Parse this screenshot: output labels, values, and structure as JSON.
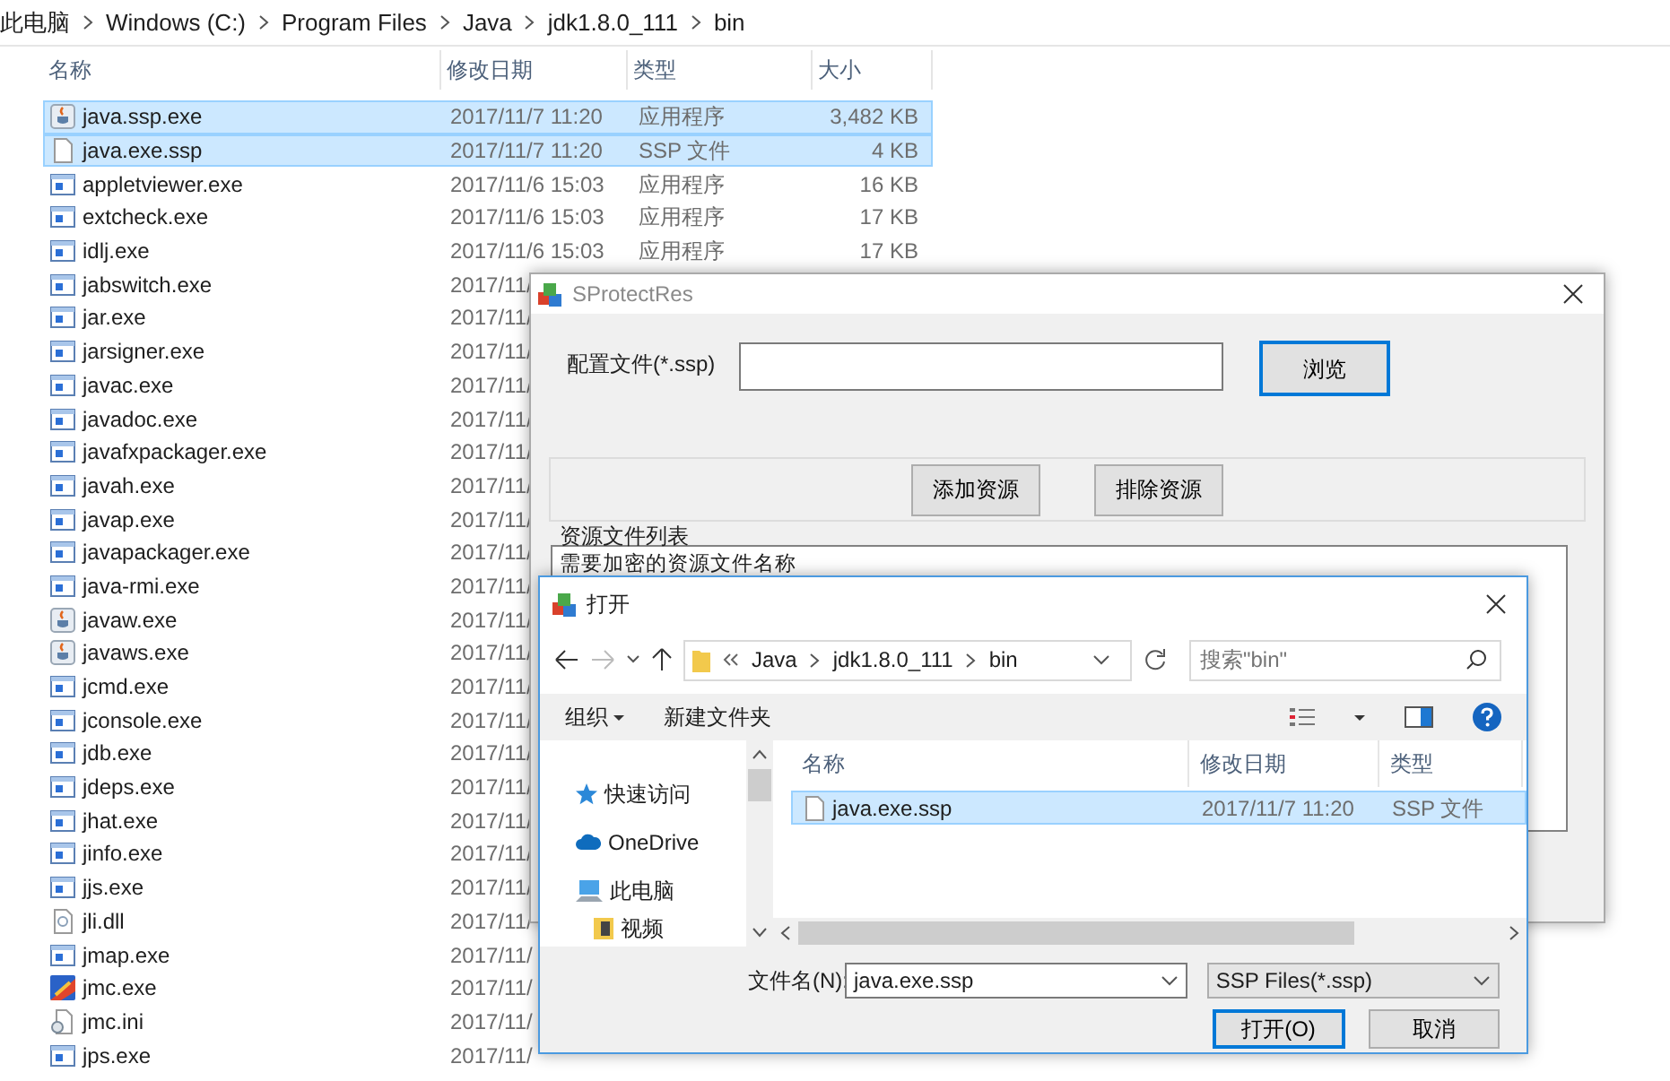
{
  "explorer": {
    "breadcrumb": [
      "此电脑",
      "Windows (C:)",
      "Program Files",
      "Java",
      "jdk1.8.0_111",
      "bin"
    ],
    "columns": [
      "名称",
      "修改日期",
      "类型",
      "大小"
    ],
    "files": [
      {
        "name": "java.ssp.exe",
        "kind": "java",
        "date": "2017/11/7 11:20",
        "type": "应用程序",
        "size": "3,482 KB",
        "selected": true
      },
      {
        "name": "java.exe.ssp",
        "kind": "file",
        "date": "2017/11/7 11:20",
        "type": "SSP 文件",
        "size": "4 KB",
        "selected": true
      },
      {
        "name": "appletviewer.exe",
        "kind": "exe",
        "date": "2017/11/6 15:03",
        "type": "应用程序",
        "size": "16 KB",
        "selected": false
      },
      {
        "name": "extcheck.exe",
        "kind": "exe",
        "date": "2017/11/6 15:03",
        "type": "应用程序",
        "size": "17 KB",
        "selected": false
      },
      {
        "name": "idlj.exe",
        "kind": "exe",
        "date": "2017/11/6 15:03",
        "type": "应用程序",
        "size": "17 KB",
        "selected": false
      },
      {
        "name": "jabswitch.exe",
        "kind": "exe",
        "date": "2017/11/",
        "selected": false
      },
      {
        "name": "jar.exe",
        "kind": "exe",
        "date": "2017/11/",
        "selected": false
      },
      {
        "name": "jarsigner.exe",
        "kind": "exe",
        "date": "2017/11/",
        "selected": false
      },
      {
        "name": "javac.exe",
        "kind": "exe",
        "date": "2017/11/",
        "selected": false
      },
      {
        "name": "javadoc.exe",
        "kind": "exe",
        "date": "2017/11/",
        "selected": false
      },
      {
        "name": "javafxpackager.exe",
        "kind": "exe",
        "date": "2017/11/",
        "selected": false
      },
      {
        "name": "javah.exe",
        "kind": "exe",
        "date": "2017/11/",
        "selected": false
      },
      {
        "name": "javap.exe",
        "kind": "exe",
        "date": "2017/11/",
        "selected": false
      },
      {
        "name": "javapackager.exe",
        "kind": "exe",
        "date": "2017/11/",
        "selected": false
      },
      {
        "name": "java-rmi.exe",
        "kind": "exe",
        "date": "2017/11/",
        "selected": false
      },
      {
        "name": "javaw.exe",
        "kind": "java",
        "date": "2017/11/",
        "selected": false
      },
      {
        "name": "javaws.exe",
        "kind": "java",
        "date": "2017/11/",
        "selected": false
      },
      {
        "name": "jcmd.exe",
        "kind": "exe",
        "date": "2017/11/",
        "selected": false
      },
      {
        "name": "jconsole.exe",
        "kind": "exe",
        "date": "2017/11/",
        "selected": false
      },
      {
        "name": "jdb.exe",
        "kind": "exe",
        "date": "2017/11/",
        "selected": false
      },
      {
        "name": "jdeps.exe",
        "kind": "exe",
        "date": "2017/11/",
        "selected": false
      },
      {
        "name": "jhat.exe",
        "kind": "exe",
        "date": "2017/11/",
        "selected": false
      },
      {
        "name": "jinfo.exe",
        "kind": "exe",
        "date": "2017/11/",
        "selected": false
      },
      {
        "name": "jjs.exe",
        "kind": "exe",
        "date": "2017/11/",
        "selected": false
      },
      {
        "name": "jli.dll",
        "kind": "dll",
        "date": "2017/11/",
        "selected": false
      },
      {
        "name": "jmap.exe",
        "kind": "exe",
        "date": "2017/11/",
        "selected": false
      },
      {
        "name": "jmc.exe",
        "kind": "app",
        "date": "2017/11/",
        "selected": false
      },
      {
        "name": "jmc.ini",
        "kind": "ini",
        "date": "2017/11/",
        "selected": false
      },
      {
        "name": "jps.exe",
        "kind": "exe",
        "date": "2017/11/",
        "selected": false
      }
    ]
  },
  "sprotect": {
    "title": "SProtectRes",
    "config_label": "配置文件(*.ssp)",
    "browse_button": "浏览",
    "buttons": [
      "添加资源",
      "排除资源"
    ],
    "group_label": "资源文件列表",
    "list_header": "需要加密的资源文件名称"
  },
  "open_dialog": {
    "title": "打开",
    "path": [
      "Java",
      "jdk1.8.0_111",
      "bin"
    ],
    "search": {
      "placeholder": "搜索\"bin\""
    },
    "toolbar": [
      "组织",
      "新建文件夹"
    ],
    "nav": [
      {
        "label": "快速访问",
        "kind": "star"
      },
      {
        "label": "OneDrive",
        "kind": "cloud"
      },
      {
        "label": "此电脑",
        "kind": "computer",
        "children": [
          {
            "label": "视频",
            "kind": "video"
          }
        ]
      }
    ],
    "columns": [
      "名称",
      "修改日期",
      "类型"
    ],
    "files": [
      {
        "name": "java.exe.ssp",
        "date": "2017/11/7 11:20",
        "type": "SSP 文件",
        "selected": true
      }
    ],
    "filename_label": "文件名(N):",
    "filename": "java.exe.ssp",
    "filter": "SSP Files(*.ssp)",
    "buttons": [
      "打开(O)",
      "取消"
    ]
  }
}
